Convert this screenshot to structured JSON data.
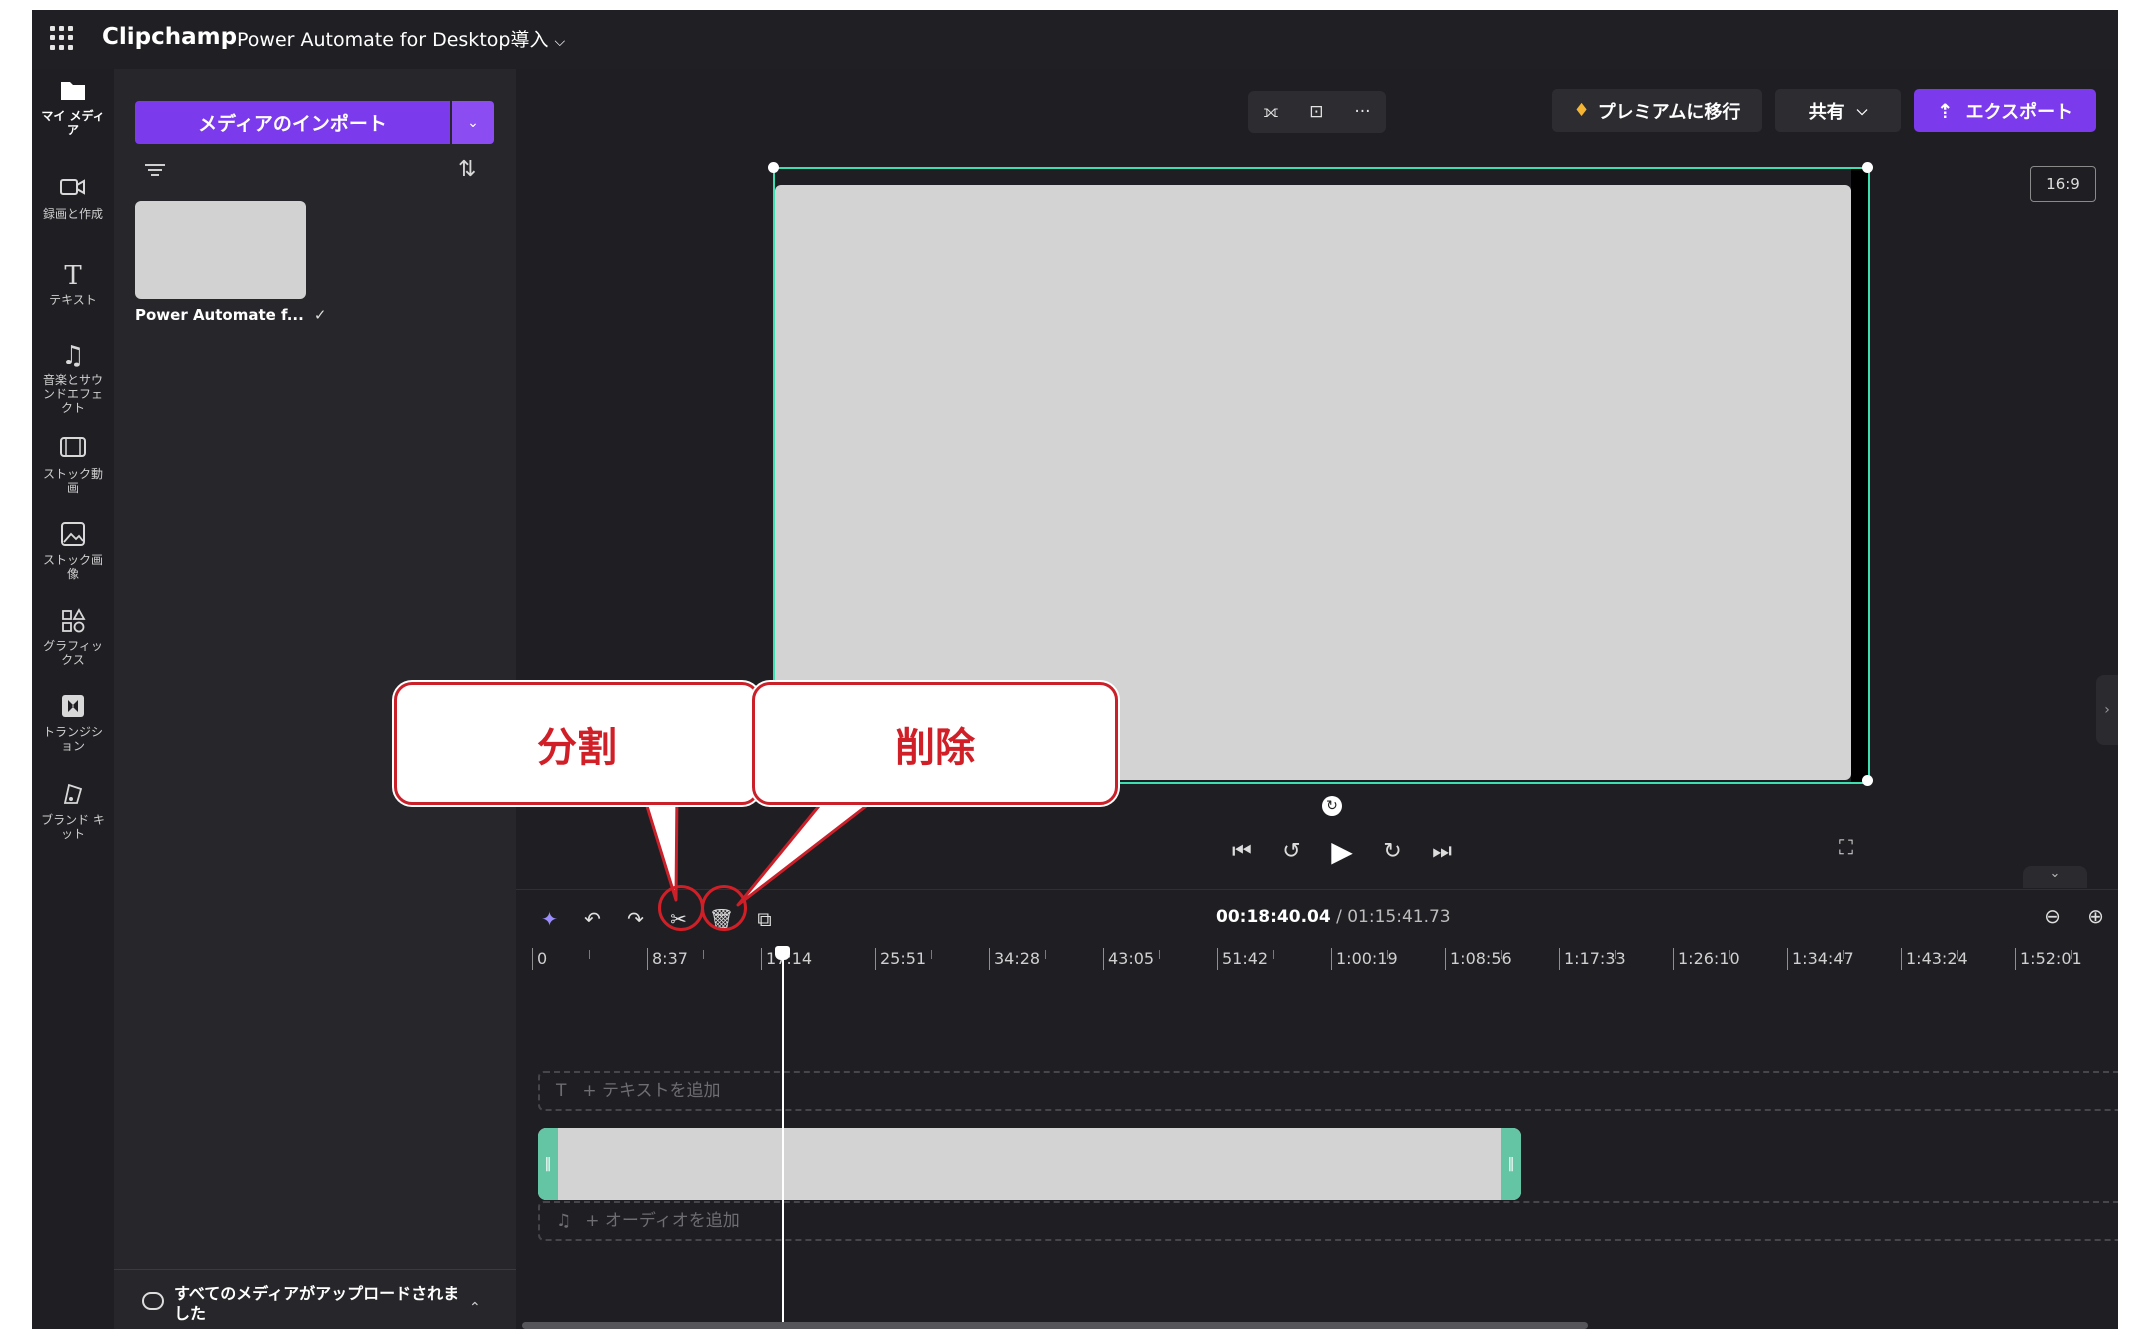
{
  "header": {
    "app_name": "Clipchamp",
    "project_title": "Power Automate for Desktop導入"
  },
  "sidebar": {
    "items": [
      {
        "label": "マイ メディア",
        "icon": "folder-icon"
      },
      {
        "label": "録画と作成",
        "icon": "camera-icon"
      },
      {
        "label": "テキスト",
        "icon": "text-icon"
      },
      {
        "label": "音楽とサウンドエフェクト",
        "icon": "music-icon"
      },
      {
        "label": "ストック動画",
        "icon": "film-icon"
      },
      {
        "label": "ストック画像",
        "icon": "image-icon"
      },
      {
        "label": "グラフィックス",
        "icon": "shapes-icon"
      },
      {
        "label": "トランジション",
        "icon": "transition-icon"
      },
      {
        "label": "ブランド キット",
        "icon": "brand-kit-icon"
      }
    ]
  },
  "media": {
    "import_label": "メディアのインポート",
    "item_name": "Power Automate f...",
    "upload_status": "すべてのメディアがアップロードされました"
  },
  "preview": {
    "premium_label": "プレミアムに移行",
    "share_label": "共有",
    "export_label": "エクスポート",
    "aspect_ratio": "16:9"
  },
  "timeline": {
    "current_time": "00:18:40.04",
    "total_time": "/ 01:15:41.73",
    "ruler": [
      "0",
      "8:37",
      "17:14",
      "25:51",
      "34:28",
      "43:05",
      "51:42",
      "1:00:19",
      "1:08:56",
      "1:17:33",
      "1:26:10",
      "1:34:47",
      "1:43:24",
      "1:52:01"
    ],
    "add_text_label": "+ テキストを追加",
    "add_audio_label": "+ オーディオを追加"
  },
  "annotations": {
    "split_label": "分割",
    "delete_label": "削除"
  },
  "colors": {
    "accent": "#7c3aed",
    "selection": "#3ddfb1",
    "annotation_red": "#d11f28"
  }
}
